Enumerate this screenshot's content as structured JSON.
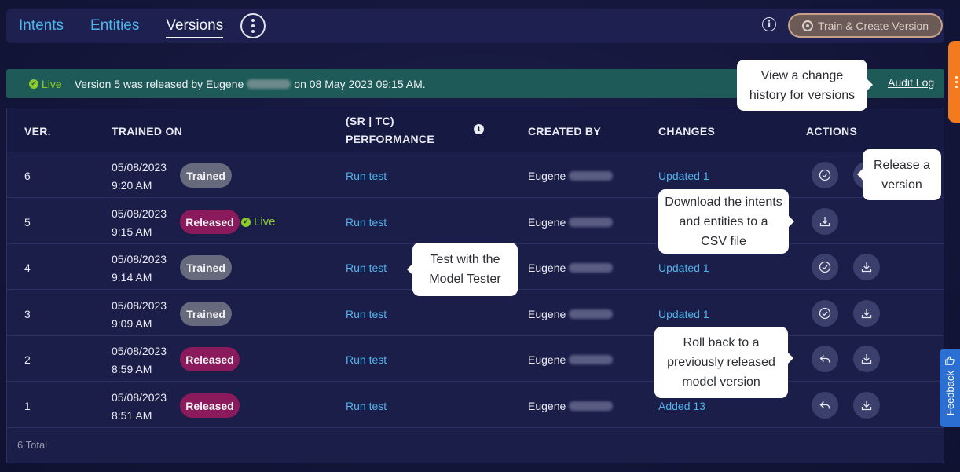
{
  "nav": {
    "tabs": [
      {
        "label": "Intents",
        "active": false
      },
      {
        "label": "Entities",
        "active": false
      },
      {
        "label": "Versions",
        "active": true
      }
    ],
    "more_icon": "vertical-dots-icon",
    "info_icon": "info-icon",
    "train_button": "Train & Create Version"
  },
  "banner": {
    "live_label": "Live",
    "text_before": "Version 5 was released by Eugene",
    "text_after": "on 08 May 2023 09:15 AM.",
    "audit_log": "Audit Log"
  },
  "table": {
    "headers": {
      "ver": "VER.",
      "trained_on": "TRAINED ON",
      "performance_line1": "(SR | TC)",
      "performance_line2": "PERFORMANCE",
      "created_by": "CREATED BY",
      "changes": "CHANGES",
      "actions": "ACTIONS"
    },
    "rows": [
      {
        "ver": "6",
        "date": "05/08/2023",
        "time": "9:20 AM",
        "status": "Trained",
        "live": "",
        "perf": "Run test",
        "creator": "Eugene",
        "changes": "Updated 1"
      },
      {
        "ver": "5",
        "date": "05/08/2023",
        "time": "9:15 AM",
        "status": "Released",
        "live": "Live",
        "perf": "Run test",
        "creator": "Eugene",
        "changes": ""
      },
      {
        "ver": "4",
        "date": "05/08/2023",
        "time": "9:14 AM",
        "status": "Trained",
        "live": "",
        "perf": "Run test",
        "creator": "Eugene",
        "changes": "Updated 1"
      },
      {
        "ver": "3",
        "date": "05/08/2023",
        "time": "9:09 AM",
        "status": "Trained",
        "live": "",
        "perf": "Run test",
        "creator": "Eugene",
        "changes": "Updated 1"
      },
      {
        "ver": "2",
        "date": "05/08/2023",
        "time": "8:59 AM",
        "status": "Released",
        "live": "",
        "perf": "Run test",
        "creator": "Eugene",
        "changes": ""
      },
      {
        "ver": "1",
        "date": "05/08/2023",
        "time": "8:51 AM",
        "status": "Released",
        "live": "",
        "perf": "Run test",
        "creator": "Eugene",
        "changes": "Added 13"
      }
    ],
    "total": "6 Total"
  },
  "callouts": {
    "audit": "View a change history for versions",
    "release": "Release a version",
    "download": "Download the intents and entities to a CSV file",
    "tester": "Test with the Model Tester",
    "rollback": "Roll back to a previously released model version"
  },
  "feedback": "Feedback",
  "colors": {
    "background": "#14163a",
    "link": "#4fb3ec",
    "live_green": "#8dcb2d",
    "released_badge": "#8b1a5c",
    "trained_badge": "#666a7c",
    "banner": "#1d5a58",
    "train_button": "#6b5a55",
    "feedback": "#2c6fd2",
    "side_tab": "#f47a20"
  }
}
